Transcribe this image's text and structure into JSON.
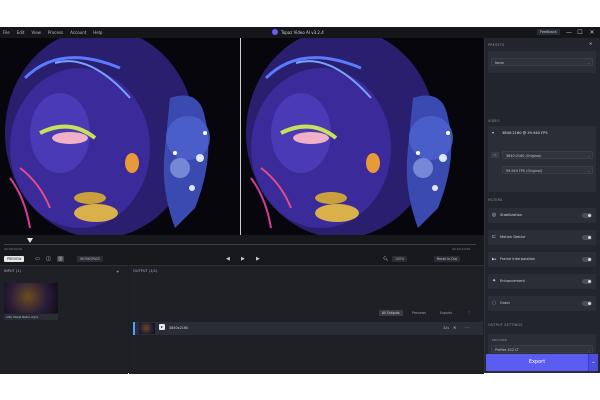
{
  "menu": [
    "File",
    "Edit",
    "View",
    "Process",
    "Account",
    "Help"
  ],
  "app_title": "Topaz Video AI  v3.2.4",
  "feedback": "Feedback",
  "window_controls": [
    "—",
    "☐",
    "✕"
  ],
  "timeline": {
    "start_tc": "00:00:00:00",
    "end_tc": "00:00:10:09",
    "preview_label": "PREVIEW",
    "workspace_label": "WORKSPACE",
    "zoom": "100%",
    "timecode_btn": "Reset In-Out",
    "playhead_fraction": 0.055
  },
  "input": {
    "header": "INPUT (1)",
    "file_name": "ulta Violet Retro.mp4"
  },
  "output": {
    "header": "OUTPUT (1/1)",
    "tabs": [
      "All Outputs",
      "Previews",
      "Exports"
    ],
    "row_name": "3840x2160",
    "row_size": "32s"
  },
  "presets": {
    "title": "PRESETS",
    "value": "None"
  },
  "video": {
    "title": "VIDEO",
    "summary": "3840:2160 @ 59.940 FPS",
    "resolution": "3840:2160 (Original)",
    "fps": "59.940 FPS (Original)"
  },
  "filters": {
    "title": "FILTERS",
    "items": [
      {
        "label": "Stabilization",
        "icon": "◎"
      },
      {
        "label": "Motion Deblur",
        "icon": "⊏"
      },
      {
        "label": "Frame Interpolation",
        "icon": "▶▸"
      },
      {
        "label": "Enhancement",
        "icon": "✦"
      },
      {
        "label": "Grain",
        "icon": "◌"
      }
    ]
  },
  "output_settings": {
    "title": "OUTPUT SETTINGS",
    "encoder_label": "ENCODER",
    "encoder_value": "ProRes 422 LT",
    "container_label": "CONTAINER",
    "audio_label": "AUDIO SETTINGS"
  },
  "export_label": "Export"
}
